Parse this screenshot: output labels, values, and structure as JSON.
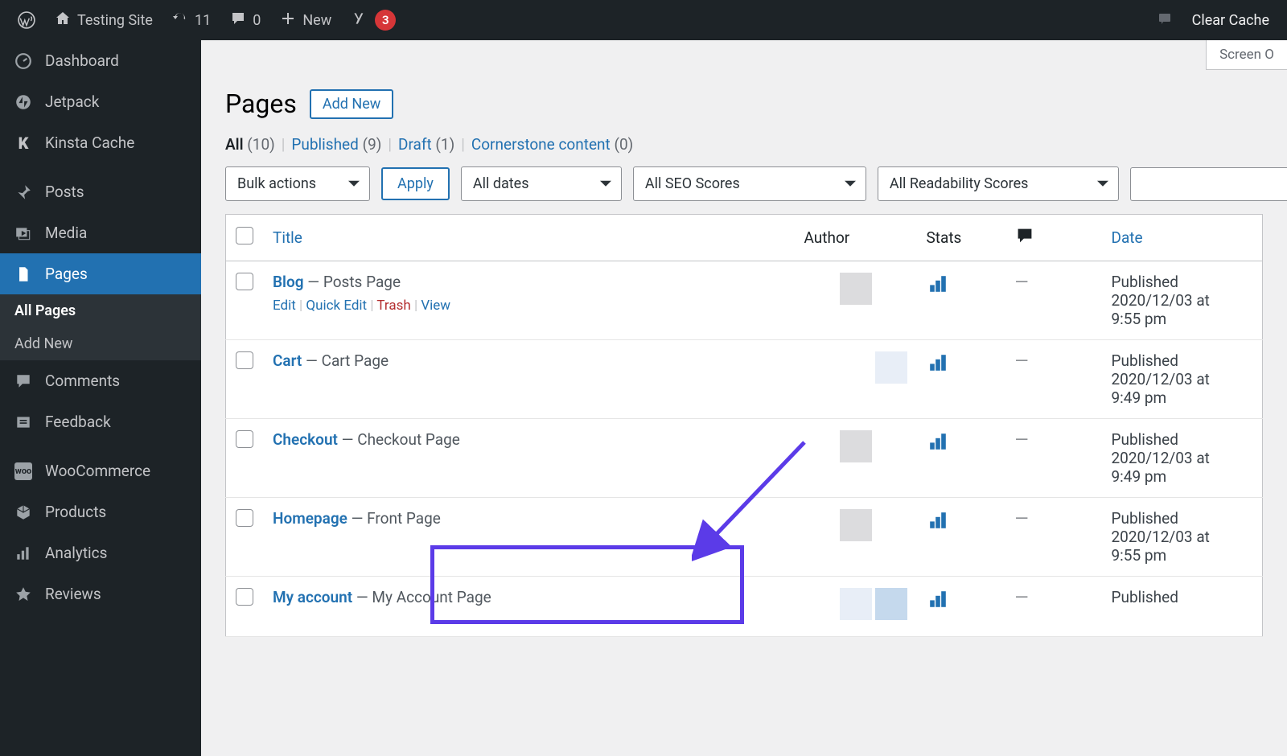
{
  "adminbar": {
    "site_name": "Testing Site",
    "updates_count": "11",
    "comments_count": "0",
    "new_label": "New",
    "yoast_badge": "3",
    "clear_cache": "Clear Cache"
  },
  "sidebar": {
    "items": [
      {
        "label": "Dashboard",
        "icon": "dashboard"
      },
      {
        "label": "Jetpack",
        "icon": "jetpack"
      },
      {
        "label": "Kinsta Cache",
        "icon": "kinsta"
      },
      {
        "label": "Posts",
        "icon": "pin"
      },
      {
        "label": "Media",
        "icon": "media"
      },
      {
        "label": "Pages",
        "icon": "pages"
      },
      {
        "label": "Comments",
        "icon": "comment"
      },
      {
        "label": "Feedback",
        "icon": "feedback"
      },
      {
        "label": "WooCommerce",
        "icon": "woo"
      },
      {
        "label": "Products",
        "icon": "products"
      },
      {
        "label": "Analytics",
        "icon": "analytics"
      },
      {
        "label": "Reviews",
        "icon": "star"
      }
    ],
    "sub": {
      "all_pages": "All Pages",
      "add_new": "Add New"
    }
  },
  "screen_options_label": "Screen O",
  "page_heading": "Pages",
  "add_new_button": "Add New",
  "filters": {
    "all": "All",
    "all_count": "(10)",
    "published": "Published",
    "published_count": "(9)",
    "draft": "Draft",
    "draft_count": "(1)",
    "cornerstone": "Cornerstone content",
    "cornerstone_count": "(0)"
  },
  "tablenav": {
    "bulk_actions": "Bulk actions",
    "apply": "Apply",
    "all_dates": "All dates",
    "all_seo": "All SEO Scores",
    "all_readability": "All Readability Scores"
  },
  "columns": {
    "title": "Title",
    "author": "Author",
    "stats": "Stats",
    "date": "Date"
  },
  "row_actions": {
    "edit": "Edit",
    "quick_edit": "Quick Edit",
    "trash": "Trash",
    "view": "View"
  },
  "rows": [
    {
      "title": "Blog",
      "suffix": " — Posts Page",
      "date_status": "Published",
      "date_line2": "2020/12/03 at",
      "date_line3": "9:55 pm",
      "author_colors": [
        "sq4",
        "sq1",
        "sq4"
      ],
      "show_actions": true,
      "dash": "—"
    },
    {
      "title": "Cart",
      "suffix": " — Cart Page",
      "date_status": "Published",
      "date_line2": "2020/12/03 at",
      "date_line3": "9:49 pm",
      "author_colors": [
        "sq4",
        "sq4",
        "sq2"
      ],
      "dash": "—"
    },
    {
      "title": "Checkout",
      "suffix": " — Checkout Page",
      "date_status": "Published",
      "date_line2": "2020/12/03 at",
      "date_line3": "9:49 pm",
      "author_colors": [
        "sq4",
        "sq1",
        "sq4"
      ],
      "dash": "—"
    },
    {
      "title": "Homepage",
      "suffix": " — Front Page",
      "date_status": "Published",
      "date_line2": "2020/12/03 at",
      "date_line3": "9:55 pm",
      "author_colors": [
        "sq4",
        "sq1",
        "sq4"
      ],
      "dash": "—"
    },
    {
      "title": "My account",
      "suffix": " — My Account Page",
      "date_status": "Published",
      "date_line2": "",
      "date_line3": "",
      "author_colors": [
        "sq4",
        "sq2",
        "sq3"
      ],
      "dash": "—"
    }
  ]
}
